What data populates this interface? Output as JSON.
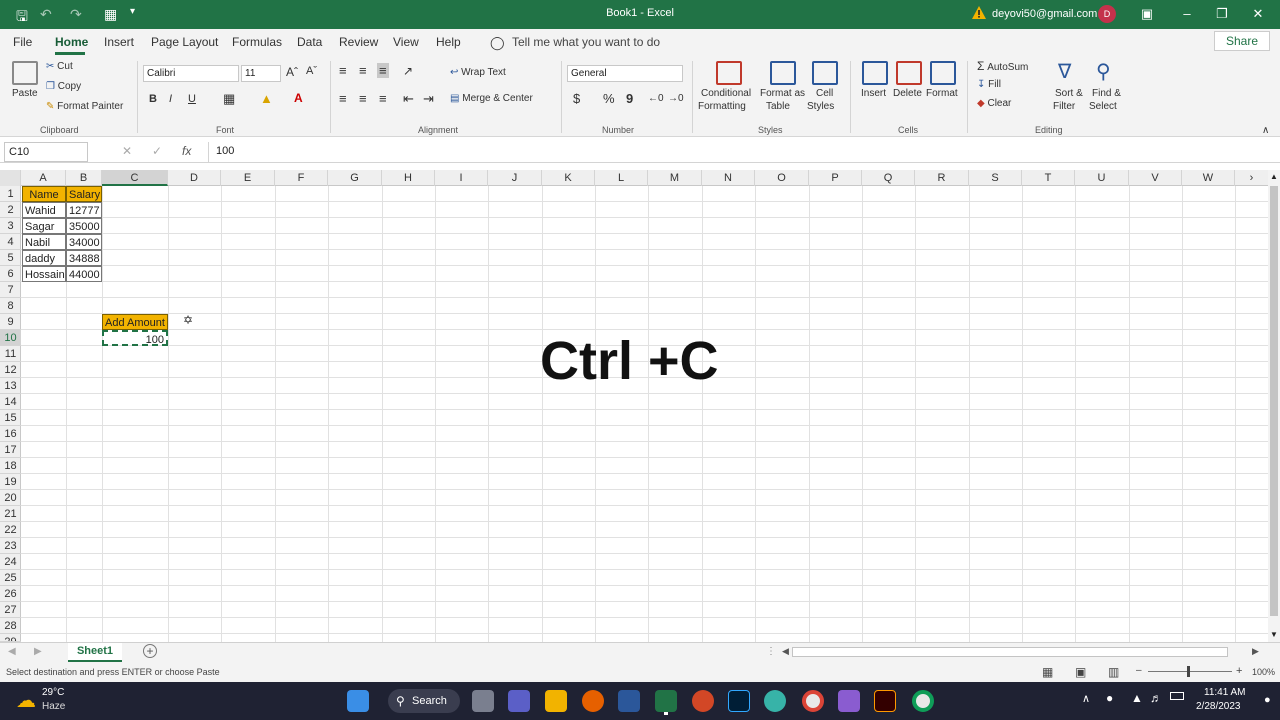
{
  "title_bar": {
    "doc_title": "Book1  -  Excel",
    "account": "deyovi50@gmail.com",
    "avatar_initial": "D"
  },
  "menu": {
    "items": [
      "File",
      "Home",
      "Insert",
      "Page Layout",
      "Formulas",
      "Data",
      "Review",
      "View",
      "Help"
    ],
    "tell_me": "Tell me what you want to do",
    "share": "Share"
  },
  "ribbon": {
    "clipboard": {
      "paste": "Paste",
      "cut": "Cut",
      "copy": "Copy",
      "format_painter": "Format Painter",
      "label": "Clipboard"
    },
    "font": {
      "name": "Calibri",
      "size": "11",
      "bold": "B",
      "italic": "I",
      "underline": "U",
      "label": "Font"
    },
    "alignment": {
      "wrap": "Wrap Text",
      "merge": "Merge & Center",
      "label": "Alignment"
    },
    "number": {
      "format": "General",
      "currency": "$",
      "percent": "%",
      "comma": "9",
      "label": "Number"
    },
    "styles": {
      "cond1": "Conditional",
      "cond2": "Formatting",
      "fmt1": "Format as",
      "fmt2": "Table",
      "cell1": "Cell",
      "cell2": "Styles",
      "label": "Styles"
    },
    "cells": {
      "insert": "Insert",
      "delete": "Delete",
      "format": "Format",
      "label": "Cells"
    },
    "editing": {
      "autosum": "AutoSum",
      "fill": "Fill",
      "clear": "Clear",
      "sort1": "Sort &",
      "sort2": "Filter",
      "find1": "Find &",
      "find2": "Select",
      "label": "Editing"
    }
  },
  "formula_bar": {
    "name_box": "C10",
    "fx": "fx",
    "value": "100"
  },
  "columns": [
    "A",
    "B",
    "C",
    "D",
    "E",
    "F",
    "G",
    "H",
    "I",
    "J",
    "K",
    "L",
    "M",
    "N",
    "O",
    "P",
    "Q",
    "R",
    "S",
    "T",
    "U",
    "V",
    "W"
  ],
  "rows": [
    "1",
    "2",
    "3",
    "4",
    "5",
    "6",
    "7",
    "8",
    "9",
    "10",
    "11",
    "12",
    "13",
    "14",
    "15",
    "16",
    "17",
    "18",
    "19",
    "20",
    "21",
    "22",
    "23",
    "24",
    "25",
    "26",
    "27",
    "28",
    "29"
  ],
  "sheet": {
    "header": {
      "name": "Name",
      "salary": "Salary"
    },
    "data": [
      {
        "name": "Wahid",
        "salary": "12777"
      },
      {
        "name": "Sagar",
        "salary": "35000"
      },
      {
        "name": "Nabil",
        "salary": "34000"
      },
      {
        "name": "daddy",
        "salary": "34888"
      },
      {
        "name": "Hossain",
        "salary": "44000"
      }
    ],
    "add_amount_label": "Add Amount",
    "add_amount_value": "100"
  },
  "overlay_text": "Ctrl +C",
  "tabs": {
    "sheet1": "Sheet1"
  },
  "status": {
    "message": "Select destination and press ENTER or choose Paste",
    "zoom": "100%"
  },
  "taskbar": {
    "temp": "29°C",
    "weather": "Haze",
    "search": "Search",
    "time": "11:41 AM",
    "date": "2/28/2023"
  },
  "colors": {
    "excel_green": "#217346",
    "header_fill": "#f2b300"
  }
}
